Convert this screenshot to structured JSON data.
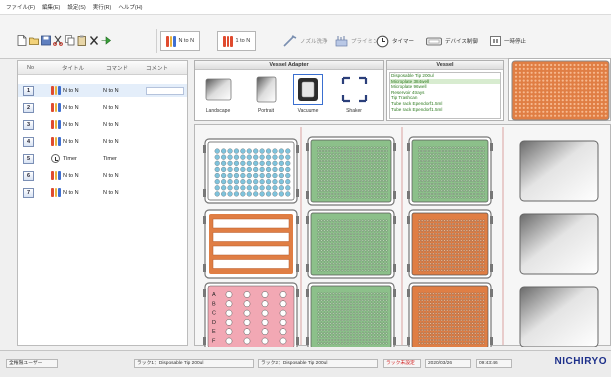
{
  "menu": [
    "ファイル(F)",
    "編集(E)",
    "設定(S)",
    "実行(R)",
    "ヘルプ(H)"
  ],
  "toolbar": {
    "n_to_n": "N to N",
    "one_to_n": "1 to N",
    "nozzle_wash": "ノズル洗浄",
    "priming": "プライミング",
    "timer": "タイマー",
    "device_control": "デバイス制御",
    "pause": "一時停止"
  },
  "steps": {
    "headers": {
      "no": "No",
      "title": "タイトル",
      "command": "コマンド",
      "comment": "コメント"
    },
    "rows": [
      {
        "no": "1",
        "title": "N to N",
        "command": "N to N",
        "icon": "tubes-icon"
      },
      {
        "no": "2",
        "title": "N to N",
        "command": "N to N",
        "icon": "tubes-icon"
      },
      {
        "no": "3",
        "title": "N to N",
        "command": "N to N",
        "icon": "tubes-icon"
      },
      {
        "no": "4",
        "title": "N to N",
        "command": "N to N",
        "icon": "tubes-icon"
      },
      {
        "no": "5",
        "title": "Timer",
        "command": "Timer",
        "icon": "timer-icon"
      },
      {
        "no": "6",
        "title": "N to N",
        "command": "N to N",
        "icon": "tubes-icon"
      },
      {
        "no": "7",
        "title": "N to N",
        "command": "N to N",
        "icon": "tubes-icon"
      }
    ]
  },
  "adapter": {
    "title": "Vessel Adapter",
    "options": [
      "Landscape",
      "Portrait",
      "Vacuume",
      "Shaker"
    ],
    "selected": "Vacuume"
  },
  "vessel": {
    "title": "Vessel",
    "items": [
      "Disposable Tip 200ul",
      "Microplate 384well",
      "Microplate 96well",
      "Reservoir 4trays",
      "Tip Trashcan",
      "Tube rack Ependorf1.5ml",
      "Tube rack Ependorf1.5ml"
    ],
    "selected_index": 1
  },
  "deck": {
    "row_labels": [
      "A",
      "B",
      "C",
      "D",
      "E",
      "F"
    ]
  },
  "status": {
    "user": "全権限ユーザー",
    "tip1": "ラック1：Disposable Tip 200ul",
    "tip2": "ラック2：Disposable Tip 200ul",
    "warn": "ラック未設定",
    "date": "2020/03/26",
    "time": "09:43:46"
  },
  "brand": "NICHIRYO",
  "colors": {
    "blue_well": "#7fc3dc",
    "green_plate": "#8cc08a",
    "orange_plate": "#e07e44",
    "pink_plate": "#f2a8b4"
  }
}
